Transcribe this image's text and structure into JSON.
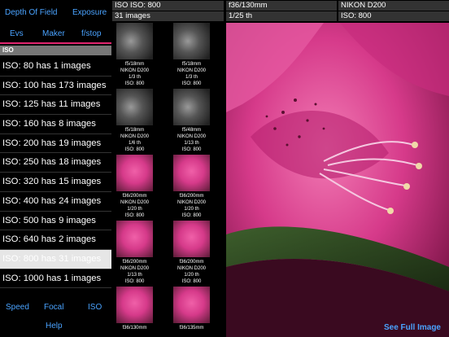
{
  "topnav": {
    "depth_of_field": "Depth Of Field",
    "exposure": "Exposure"
  },
  "tabs": {
    "evs": "Evs",
    "maker": "Maker",
    "fstop": "f/stop"
  },
  "section": {
    "label": "ISO"
  },
  "iso_list": [
    {
      "label": "ISO:   80 has 1 images",
      "selected": false
    },
    {
      "label": "ISO:  100 has 173 images",
      "selected": false
    },
    {
      "label": "ISO:  125 has 11 images",
      "selected": false
    },
    {
      "label": "ISO:  160 has 8 images",
      "selected": false
    },
    {
      "label": "ISO:  200 has 19 images",
      "selected": false
    },
    {
      "label": "ISO:  250 has 18 images",
      "selected": false
    },
    {
      "label": "ISO:  320 has 15 images",
      "selected": false
    },
    {
      "label": "ISO:  400 has 24 images",
      "selected": false
    },
    {
      "label": "ISO:  500 has 9 images",
      "selected": false
    },
    {
      "label": "ISO:  640 has 2 images",
      "selected": false
    },
    {
      "label": "ISO:  800 has 31 images",
      "selected": true
    },
    {
      "label": "ISO: 1000 has 1 images",
      "selected": false
    }
  ],
  "bottomnav": {
    "speed": "Speed",
    "focal": "Focal",
    "iso": "ISO",
    "help": "Help"
  },
  "grid_header": {
    "title": "ISO ISO:  800",
    "count": "31 images"
  },
  "detail_header": {
    "lens": "f36/130mm",
    "camera": "NIKON D200",
    "shutter": "1/25 th",
    "iso": "ISO:  800"
  },
  "thumbnails": [
    {
      "l1": "f5/18mm",
      "l2": "NIKON D200",
      "l3": "1/3 th",
      "l4": "ISO:  800",
      "kind": "bw"
    },
    {
      "l1": "f5/18mm",
      "l2": "NIKON D200",
      "l3": "1/3 th",
      "l4": "ISO:  800",
      "kind": "bw"
    },
    {
      "l1": "f5/18mm",
      "l2": "NIKON D200",
      "l3": "1/6 th",
      "l4": "ISO:  800",
      "kind": "bw"
    },
    {
      "l1": "f5/48mm",
      "l2": "NIKON D200",
      "l3": "1/13 th",
      "l4": "ISO:  800",
      "kind": "bw"
    },
    {
      "l1": "f36/200mm",
      "l2": "NIKON D200",
      "l3": "1/20 th",
      "l4": "ISO:  800",
      "kind": "pink"
    },
    {
      "l1": "f36/200mm",
      "l2": "NIKON D200",
      "l3": "1/20 th",
      "l4": "ISO:  800",
      "kind": "pink"
    },
    {
      "l1": "f36/200mm",
      "l2": "NIKON D200",
      "l3": "1/13 th",
      "l4": "ISO:  800",
      "kind": "pink"
    },
    {
      "l1": "f36/200mm",
      "l2": "NIKON D200",
      "l3": "1/20 th",
      "l4": "ISO:  800",
      "kind": "pink"
    },
    {
      "l1": "f36/130mm",
      "l2": "",
      "l3": "",
      "l4": "",
      "kind": "pink"
    },
    {
      "l1": "f36/135mm",
      "l2": "",
      "l3": "",
      "l4": "",
      "kind": "pink"
    }
  ],
  "see_full": "See Full Image",
  "colors": {
    "accent": "#4aa3ff",
    "tab_underline": "#e0246f",
    "flower": "#d63a8a"
  }
}
